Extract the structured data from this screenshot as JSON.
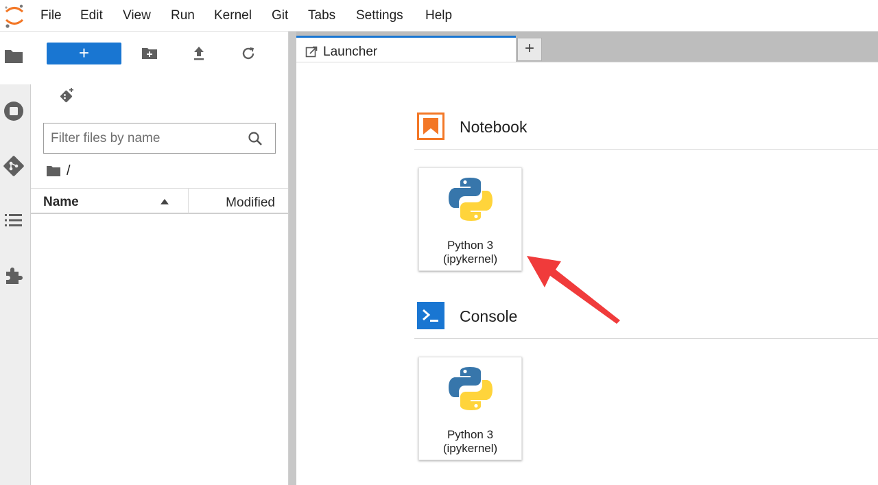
{
  "menubar": {
    "items": [
      "File",
      "Edit",
      "View",
      "Run",
      "Kernel",
      "Git",
      "Tabs",
      "Settings",
      "Help"
    ]
  },
  "activitybar": {
    "icons": [
      "folder-icon",
      "running-icon",
      "git-icon",
      "toc-icon",
      "extension-icon"
    ]
  },
  "filebrowser": {
    "new_label": "+",
    "filter_placeholder": "Filter files by name",
    "breadcrumb": "/",
    "columns": {
      "name": "Name",
      "modified": "Modified"
    }
  },
  "tabs": [
    {
      "label": "Launcher",
      "icon": "launcher-icon"
    }
  ],
  "add_tab_label": "+",
  "launcher": {
    "sections": [
      {
        "title": "Notebook",
        "icon": "notebook-icon",
        "accent": "#f37726",
        "cards": [
          {
            "line1": "Python 3",
            "line2": "(ipykernel)"
          }
        ]
      },
      {
        "title": "Console",
        "icon": "console-icon",
        "accent": "#1976d2",
        "cards": [
          {
            "line1": "Python 3",
            "line2": "(ipykernel)"
          }
        ]
      }
    ]
  },
  "colors": {
    "accent_blue": "#1976d2",
    "notebook_orange": "#f37726",
    "annotation_red": "#f03b3b"
  }
}
